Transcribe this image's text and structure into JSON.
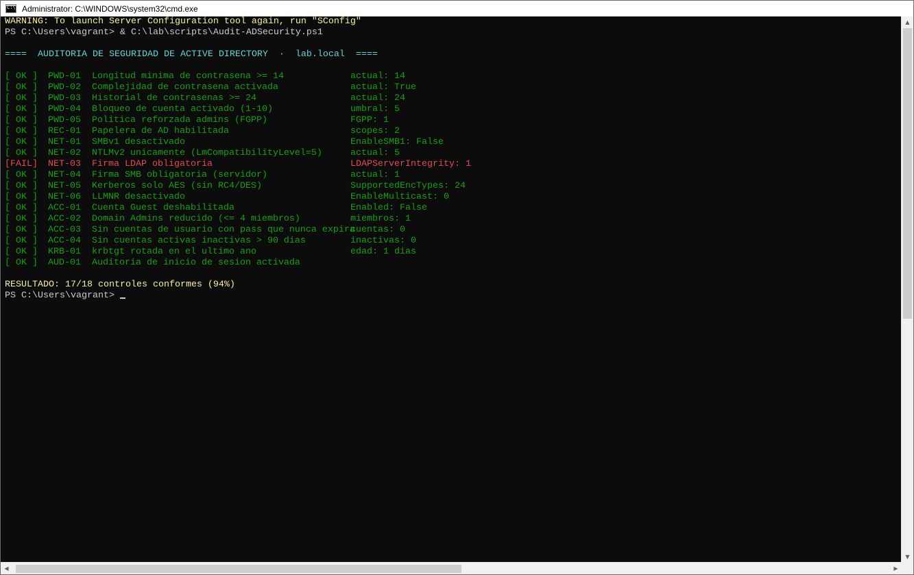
{
  "window": {
    "title": "Administrator: C:\\WINDOWS\\system32\\cmd.exe",
    "icon": "cmd-icon",
    "icon_text": "C:\\"
  },
  "console": {
    "lines_top": [
      {
        "text": "WARNING: To launch Server Configuration tool again, run \"SConfig\"",
        "color": "yellow"
      },
      {
        "text": "PS C:\\Users\\vagrant> & C:\\lab\\scripts\\Audit-ADSecurity.ps1",
        "color": "white"
      },
      {
        "text": "",
        "color": "white"
      },
      {
        "text": "====  AUDITORIA DE SEGURIDAD DE ACTIVE DIRECTORY  ·  lab.local  ====",
        "color": "cyan"
      },
      {
        "text": "",
        "color": "white"
      }
    ],
    "checks": [
      {
        "status": "[ OK ]",
        "code": "PWD-01",
        "desc": "Longitud minima de contrasena >= 14",
        "value": "actual: 14",
        "color": "green"
      },
      {
        "status": "[ OK ]",
        "code": "PWD-02",
        "desc": "Complejidad de contrasena activada",
        "value": "actual: True",
        "color": "green"
      },
      {
        "status": "[ OK ]",
        "code": "PWD-03",
        "desc": "Historial de contrasenas >= 24",
        "value": "actual: 24",
        "color": "green"
      },
      {
        "status": "[ OK ]",
        "code": "PWD-04",
        "desc": "Bloqueo de cuenta activado (1-10)",
        "value": "umbral: 5",
        "color": "green"
      },
      {
        "status": "[ OK ]",
        "code": "PWD-05",
        "desc": "Politica reforzada admins (FGPP)",
        "value": "FGPP: 1",
        "color": "green"
      },
      {
        "status": "[ OK ]",
        "code": "REC-01",
        "desc": "Papelera de AD habilitada",
        "value": "scopes: 2",
        "color": "green"
      },
      {
        "status": "[ OK ]",
        "code": "NET-01",
        "desc": "SMBv1 desactivado",
        "value": "EnableSMB1: False",
        "color": "green"
      },
      {
        "status": "[ OK ]",
        "code": "NET-02",
        "desc": "NTLMv2 unicamente (LmCompatibilityLevel=5)",
        "value": "actual: 5",
        "color": "green"
      },
      {
        "status": "[FAIL]",
        "code": "NET-03",
        "desc": "Firma LDAP obligatoria",
        "value": "LDAPServerIntegrity: 1",
        "color": "red"
      },
      {
        "status": "[ OK ]",
        "code": "NET-04",
        "desc": "Firma SMB obligatoria (servidor)",
        "value": "actual: 1",
        "color": "green"
      },
      {
        "status": "[ OK ]",
        "code": "NET-05",
        "desc": "Kerberos solo AES (sin RC4/DES)",
        "value": "SupportedEncTypes: 24",
        "color": "green"
      },
      {
        "status": "[ OK ]",
        "code": "NET-06",
        "desc": "LLMNR desactivado",
        "value": "EnableMulticast: 0",
        "color": "green"
      },
      {
        "status": "[ OK ]",
        "code": "ACC-01",
        "desc": "Cuenta Guest deshabilitada",
        "value": "Enabled: False",
        "color": "green"
      },
      {
        "status": "[ OK ]",
        "code": "ACC-02",
        "desc": "Domain Admins reducido (<= 4 miembros)",
        "value": "miembros: 1",
        "color": "green"
      },
      {
        "status": "[ OK ]",
        "code": "ACC-03",
        "desc": "Sin cuentas de usuario con pass que nunca expira",
        "value": "cuentas: 0",
        "color": "green"
      },
      {
        "status": "[ OK ]",
        "code": "ACC-04",
        "desc": "Sin cuentas activas inactivas > 90 dias",
        "value": "inactivas: 0",
        "color": "green"
      },
      {
        "status": "[ OK ]",
        "code": "KRB-01",
        "desc": "krbtgt rotada en el ultimo ano",
        "value": "edad: 1 dias",
        "color": "green"
      },
      {
        "status": "[ OK ]",
        "code": "AUD-01",
        "desc": "Auditoria de inicio de sesion activada",
        "value": "",
        "color": "green"
      }
    ],
    "result": "RESULTADO: 17/18 controles conformes (94%)",
    "prompt": "PS C:\\Users\\vagrant> "
  },
  "colors": {
    "background": "#0c0c0c",
    "yellow": "#f9f1a5",
    "cyan": "#61d6d6",
    "green": "#13a10e",
    "red": "#e74856",
    "white": "#cccccc"
  },
  "scrollbars": {
    "up_arrow": "▲",
    "down_arrow": "▼",
    "left_arrow": "◀",
    "right_arrow": "▶"
  }
}
